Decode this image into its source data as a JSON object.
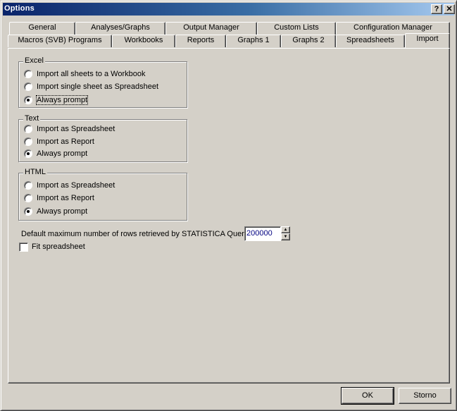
{
  "window": {
    "title": "Options",
    "help_glyph": "?",
    "close_glyph": "✕"
  },
  "tabs_row1": [
    {
      "label": "General"
    },
    {
      "label": "Analyses/Graphs"
    },
    {
      "label": "Output Manager"
    },
    {
      "label": "Custom Lists"
    },
    {
      "label": "Configuration Manager"
    }
  ],
  "tabs_row2": [
    {
      "label": "Macros (SVB) Programs"
    },
    {
      "label": "Workbooks"
    },
    {
      "label": "Reports"
    },
    {
      "label": "Graphs 1"
    },
    {
      "label": "Graphs 2"
    },
    {
      "label": "Spreadsheets"
    },
    {
      "label": "Import",
      "active": true
    }
  ],
  "excel": {
    "label": "Excel",
    "options": [
      {
        "label": "Import all sheets to a Workbook",
        "checked": false
      },
      {
        "label": "Import single sheet as Spreadsheet",
        "checked": false
      },
      {
        "label": "Always prompt",
        "checked": true
      }
    ]
  },
  "text": {
    "label": "Text",
    "options": [
      {
        "label": "Import as Spreadsheet",
        "checked": false
      },
      {
        "label": "Import as Report",
        "checked": false
      },
      {
        "label": "Always prompt",
        "checked": true
      }
    ]
  },
  "html": {
    "label": "HTML",
    "options": [
      {
        "label": "Import as Spreadsheet",
        "checked": false
      },
      {
        "label": "Import as Report",
        "checked": false
      },
      {
        "label": "Always prompt",
        "checked": true
      }
    ]
  },
  "query": {
    "label": "Default maximum number of rows retrieved by STATISTICA Query:",
    "value": "200000"
  },
  "fit": {
    "label": "Fit spreadsheet",
    "checked": false
  },
  "buttons": {
    "ok": "OK",
    "cancel": "Storno"
  }
}
